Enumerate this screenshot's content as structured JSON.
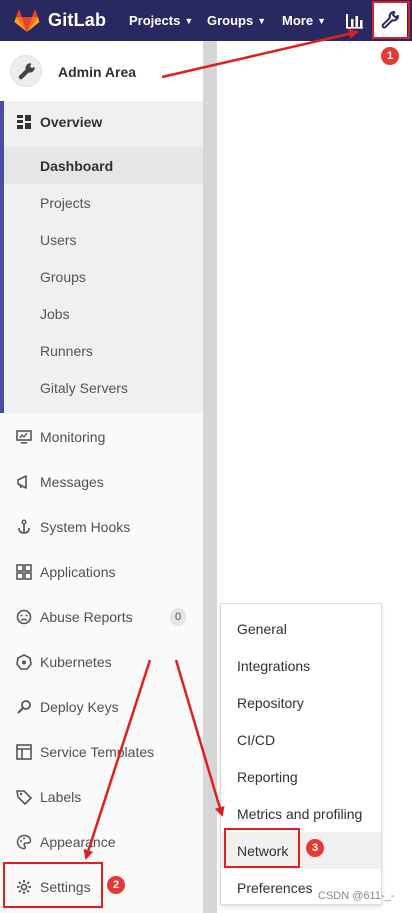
{
  "navbar": {
    "brand": "GitLab",
    "projects_label": "Projects",
    "groups_label": "Groups",
    "more_label": "More",
    "bg_color": "#292961"
  },
  "sidebar": {
    "context_title": "Admin Area",
    "overview": {
      "label": "Overview",
      "items": [
        {
          "label": "Dashboard",
          "active": true
        },
        {
          "label": "Projects"
        },
        {
          "label": "Users"
        },
        {
          "label": "Groups"
        },
        {
          "label": "Jobs"
        },
        {
          "label": "Runners"
        },
        {
          "label": "Gitaly Servers"
        }
      ]
    },
    "items": [
      {
        "label": "Monitoring",
        "icon": "monitor-icon"
      },
      {
        "label": "Messages",
        "icon": "megaphone-icon"
      },
      {
        "label": "System Hooks",
        "icon": "anchor-icon"
      },
      {
        "label": "Applications",
        "icon": "grid-icon"
      },
      {
        "label": "Abuse Reports",
        "icon": "abuse-icon",
        "badge": "0"
      },
      {
        "label": "Kubernetes",
        "icon": "kubernetes-icon"
      },
      {
        "label": "Deploy Keys",
        "icon": "key-icon"
      },
      {
        "label": "Service Templates",
        "icon": "template-icon"
      },
      {
        "label": "Labels",
        "icon": "label-icon"
      },
      {
        "label": "Appearance",
        "icon": "palette-icon"
      },
      {
        "label": "Settings",
        "icon": "gear-icon"
      }
    ]
  },
  "settings_menu": {
    "items": [
      "General",
      "Integrations",
      "Repository",
      "CI/CD",
      "Reporting",
      "Metrics and profiling",
      "Network",
      "Preferences"
    ],
    "highlighted": "Network"
  },
  "annotations": {
    "step1": "1",
    "step2": "2",
    "step3": "3",
    "color": "#e02020"
  },
  "watermark": "CSDN @611-_-"
}
